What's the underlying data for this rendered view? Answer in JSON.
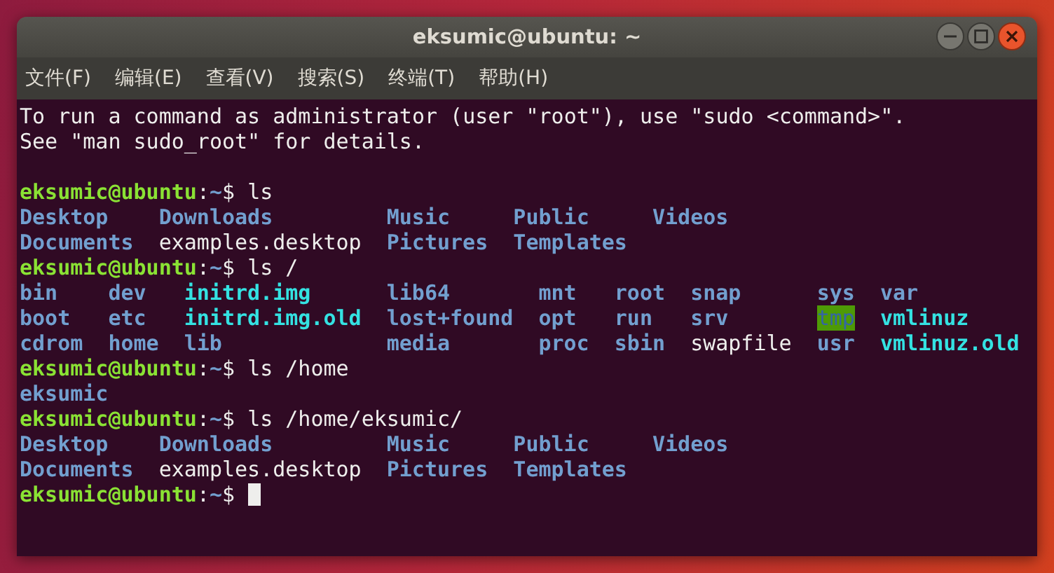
{
  "window": {
    "title": "eksumic@ubuntu: ~"
  },
  "menu": [
    "文件(F)",
    "编辑(E)",
    "查看(V)",
    "搜索(S)",
    "终端(T)",
    "帮助(H)"
  ],
  "terminal": [
    {
      "kind": "text",
      "text": "To run a command as administrator (user \"root\"), use \"sudo <command>\"."
    },
    {
      "kind": "text",
      "text": "See \"man sudo_root\" for details."
    },
    {
      "kind": "blank"
    },
    {
      "kind": "prompt",
      "user": "eksumic@ubuntu",
      "sep": ":",
      "path": "~",
      "symbol": "$",
      "command": "ls"
    },
    {
      "kind": "listing",
      "rows": [
        [
          {
            "name": "Desktop",
            "kind": "dir"
          },
          {
            "name": "Downloads",
            "kind": "dir"
          },
          {
            "name": "Music",
            "kind": "dir"
          },
          {
            "name": "Public",
            "kind": "dir"
          },
          {
            "name": "Videos",
            "kind": "dir"
          }
        ],
        [
          {
            "name": "Documents",
            "kind": "dir"
          },
          {
            "name": "examples.desktop",
            "kind": "file"
          },
          {
            "name": "Pictures",
            "kind": "dir"
          },
          {
            "name": "Templates",
            "kind": "dir"
          }
        ]
      ]
    },
    {
      "kind": "prompt",
      "user": "eksumic@ubuntu",
      "sep": ":",
      "path": "~",
      "symbol": "$",
      "command": "ls /"
    },
    {
      "kind": "listing",
      "rows": [
        [
          {
            "name": "bin",
            "kind": "dir"
          },
          {
            "name": "dev",
            "kind": "dir"
          },
          {
            "name": "initrd.img",
            "kind": "link"
          },
          {
            "name": "lib64",
            "kind": "dir"
          },
          {
            "name": "mnt",
            "kind": "dir"
          },
          {
            "name": "root",
            "kind": "dir"
          },
          {
            "name": "snap",
            "kind": "dir"
          },
          {
            "name": "sys",
            "kind": "dir"
          },
          {
            "name": "var",
            "kind": "dir"
          }
        ],
        [
          {
            "name": "boot",
            "kind": "dir"
          },
          {
            "name": "etc",
            "kind": "dir"
          },
          {
            "name": "initrd.img.old",
            "kind": "link"
          },
          {
            "name": "lost+found",
            "kind": "dir"
          },
          {
            "name": "opt",
            "kind": "dir"
          },
          {
            "name": "run",
            "kind": "dir"
          },
          {
            "name": "srv",
            "kind": "dir"
          },
          {
            "name": "tmp",
            "kind": "sticky"
          },
          {
            "name": "vmlinuz",
            "kind": "link"
          }
        ],
        [
          {
            "name": "cdrom",
            "kind": "dir"
          },
          {
            "name": "home",
            "kind": "dir"
          },
          {
            "name": "lib",
            "kind": "dir"
          },
          {
            "name": "media",
            "kind": "dir"
          },
          {
            "name": "proc",
            "kind": "dir"
          },
          {
            "name": "sbin",
            "kind": "dir"
          },
          {
            "name": "swapfile",
            "kind": "file"
          },
          {
            "name": "usr",
            "kind": "dir"
          },
          {
            "name": "vmlinuz.old",
            "kind": "link"
          }
        ]
      ]
    },
    {
      "kind": "prompt",
      "user": "eksumic@ubuntu",
      "sep": ":",
      "path": "~",
      "symbol": "$",
      "command": "ls /home"
    },
    {
      "kind": "listing",
      "rows": [
        [
          {
            "name": "eksumic",
            "kind": "dir"
          }
        ]
      ]
    },
    {
      "kind": "prompt",
      "user": "eksumic@ubuntu",
      "sep": ":",
      "path": "~",
      "symbol": "$",
      "command": "ls /home/eksumic/"
    },
    {
      "kind": "listing",
      "rows": [
        [
          {
            "name": "Desktop",
            "kind": "dir"
          },
          {
            "name": "Downloads",
            "kind": "dir"
          },
          {
            "name": "Music",
            "kind": "dir"
          },
          {
            "name": "Public",
            "kind": "dir"
          },
          {
            "name": "Videos",
            "kind": "dir"
          }
        ],
        [
          {
            "name": "Documents",
            "kind": "dir"
          },
          {
            "name": "examples.desktop",
            "kind": "file"
          },
          {
            "name": "Pictures",
            "kind": "dir"
          },
          {
            "name": "Templates",
            "kind": "dir"
          }
        ]
      ]
    },
    {
      "kind": "input",
      "user": "eksumic@ubuntu",
      "sep": ":",
      "path": "~",
      "symbol": "$"
    }
  ]
}
